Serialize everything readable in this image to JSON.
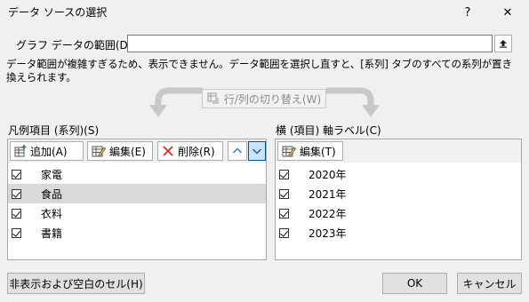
{
  "title": "データ ソースの選択",
  "title_buttons": {
    "help": "?",
    "close": "✕"
  },
  "range": {
    "label": "グラフ データの範囲(D):",
    "value": ""
  },
  "message": "データ範囲が複雑すぎるため、表示できません。データ範囲を選択し直すと、[系列] タブのすべての系列が置き換えられます。",
  "switch_label": "行/列の切り替え(W)",
  "legend": {
    "label": "凡例項目 (系列)(S)",
    "add": "追加(A)",
    "edit": "編集(E)",
    "delete": "削除(R)",
    "items": [
      "家電",
      "食品",
      "衣料",
      "書籍"
    ],
    "selected_index": 1
  },
  "axis": {
    "label": "横 (項目) 軸ラベル(C)",
    "edit": "編集(T)",
    "items": [
      "2020年",
      "2021年",
      "2022年",
      "2023年"
    ]
  },
  "footer": {
    "hidden_cells": "非表示および空白のセル(H)",
    "ok": "OK",
    "cancel": "キャンセル"
  }
}
